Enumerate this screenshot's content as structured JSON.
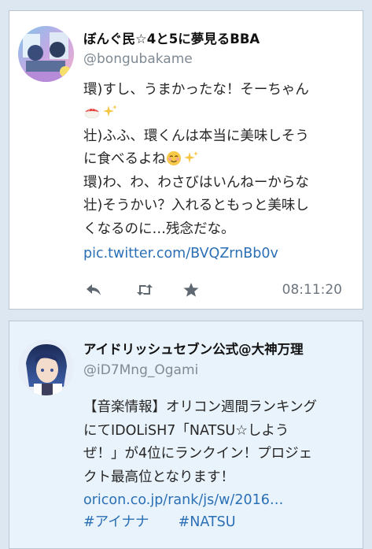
{
  "tweets": [
    {
      "name": "ぼんぐ民☆4と5に夢見るBBA",
      "handle": "@bongubakame",
      "lines": [
        "環)すし、うまかったな！そーちゃん",
        "",
        "壮)ふふ、環くんは本当に美味しそう",
        "に食べるよね",
        "環)わ、わ、わさびはいんねーからな",
        "壮)そうかい？入れるともっと美味し",
        "くなるのに…残念だな。"
      ],
      "link": "pic.twitter.com/BVQZrnBb0v",
      "time": "08:11:20",
      "icons": [
        "reply-icon",
        "retweet-icon",
        "star-icon"
      ]
    },
    {
      "name": "アイドリッシュセブン公式@大神万理",
      "handle": "@iD7Mng_Ogami",
      "lines": [
        "【音楽情報】オリコン週間ランキング",
        "にてIDOLiSH7「NATSU☆しよう",
        "ぜ！」が4位にランクイン！プロジェ",
        "クト最高位となります！"
      ],
      "link": "oricon.co.jp/rank/js/w/2016…",
      "hashtags": [
        "#アイナナ",
        "#NATSU"
      ]
    }
  ],
  "colors": {
    "background": "#dce7f1",
    "card1": "#ffffff",
    "card2": "#e9f3fb",
    "link": "#2a6fb5",
    "handle": "#7f8a93"
  }
}
